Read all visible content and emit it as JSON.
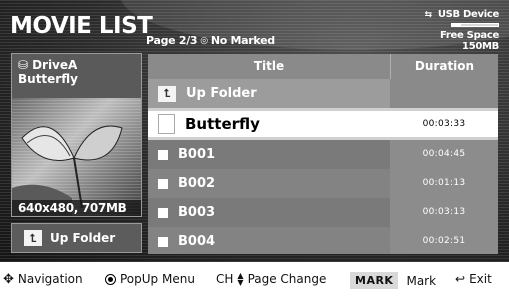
{
  "header": {
    "title": "MOVIE LIST",
    "page_info": "Page 2/3",
    "marked_icon": "circle-icon",
    "marked_text": "No Marked"
  },
  "usb": {
    "label": "USB Device",
    "icon": "usb-icon",
    "free_space": "Free Space 150MB",
    "usage_fraction": 0.2
  },
  "preview": {
    "drive_icon": "drive-icon",
    "drive_name": "DriveA",
    "file_name": "Butterfly",
    "info": "640x480, 707MB",
    "up_folder_label": "Up Folder"
  },
  "list": {
    "columns": {
      "title": "Title",
      "duration": "Duration"
    },
    "up_folder": {
      "name": "Up Folder",
      "duration": ""
    },
    "items": [
      {
        "name": "Butterfly",
        "duration": "00:03:33",
        "selected": true
      },
      {
        "name": "B001",
        "duration": "00:04:45",
        "selected": false
      },
      {
        "name": "B002",
        "duration": "00:01:13",
        "selected": false
      },
      {
        "name": "B003",
        "duration": "00:03:13",
        "selected": false
      },
      {
        "name": "B004",
        "duration": "00:02:51",
        "selected": false
      }
    ]
  },
  "footer": {
    "navigation": "Navigation",
    "popup_menu": "PopUp Menu",
    "ch": "CH",
    "page_change": "Page Change",
    "mark_badge": "MARK",
    "mark": "Mark",
    "exit": "Exit"
  },
  "colors": {
    "background": "#2a2a2a",
    "selected_row": "#ffffff",
    "panel_gray": "#7a7a7a"
  }
}
